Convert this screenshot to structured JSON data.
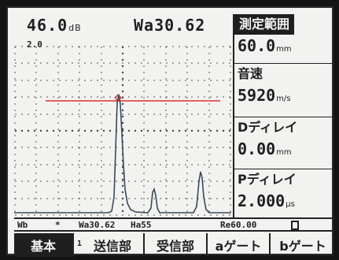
{
  "readouts": {
    "gain_value": "46.0",
    "gain_unit": "dB",
    "gain_step": "2.0",
    "wa_value": "Wa30.62"
  },
  "panel": {
    "range_label": "測定範囲",
    "range_value": "60.0",
    "range_unit": "mm",
    "velocity_label": "音速",
    "velocity_value": "5920",
    "velocity_unit": "m/s",
    "d_delay_label": "Dディレイ",
    "d_delay_value": "0.00",
    "d_delay_unit": "mm",
    "p_delay_label": "Pディレイ",
    "p_delay_value": "2.000",
    "p_delay_unit": "μs"
  },
  "status_bar": {
    "mode": "Wb",
    "marker": "*",
    "wa": "Wa30.62",
    "ha": "Ha55",
    "re": "Re60.00"
  },
  "menu": {
    "page_number": "1",
    "items": [
      {
        "label": "基本",
        "active": true
      },
      {
        "label": "送信部",
        "active": false
      },
      {
        "label": "受信部",
        "active": false
      },
      {
        "label": "aゲート",
        "active": false
      },
      {
        "label": "bゲート",
        "active": false
      }
    ]
  },
  "colors": {
    "gate_line": "#e03030",
    "trace": "#3a4a5a"
  }
}
